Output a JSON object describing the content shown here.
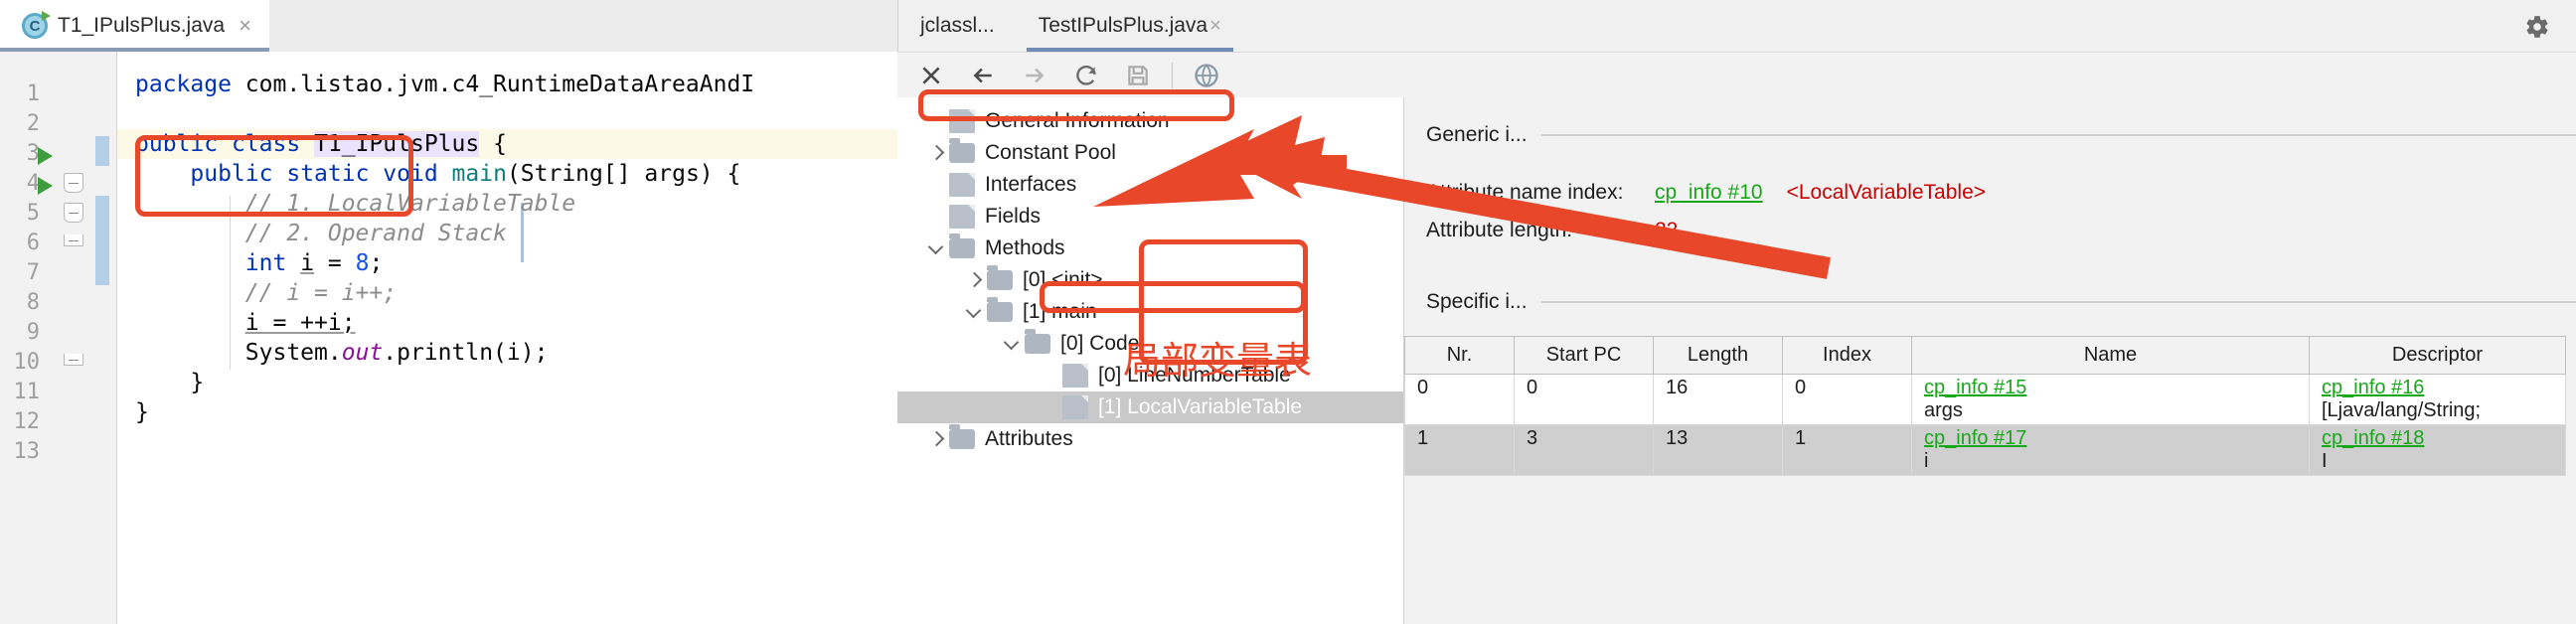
{
  "editor": {
    "tab": {
      "title": "T1_IPulsPlus.java",
      "icon": "java-class-icon",
      "close": "×"
    },
    "inspection_ok": "✓",
    "line_numbers": [
      "1",
      "2",
      "3",
      "4",
      "5",
      "6",
      "7",
      "8",
      "9",
      "10",
      "11",
      "12",
      "13"
    ],
    "lines": [
      "package com.listao.jvm.c4_RuntimeDataAreaAndI",
      "",
      "public class T1_IPulsPlus {",
      "    public static void main(String[] args) {",
      "        // 1. LocalVariableTable",
      "        // 2. Operand Stack",
      "        int i = 8;",
      "        // i = i++;",
      "        i = ++i;",
      "        System.out.println(i);",
      "    }",
      "}",
      ""
    ],
    "tokens": {
      "package_kw": "package",
      "package_name": "com.listao.jvm.c4_RuntimeDataAreaAndI",
      "public_kw": "public",
      "class_kw": "class",
      "class_name": "T1_IPulsPlus",
      "static_kw": "static",
      "void_kw": "void",
      "main_name": "main",
      "args_sig": "(String[] args) {",
      "comment1": "// 1. LocalVariableTable",
      "comment2": "// 2. Operand Stack",
      "int_kw": "int",
      "var_i": "i",
      "eq": " = ",
      "eight": "8",
      "semi": ";",
      "comment3": "// i = i++;",
      "incr": "i = ++i;",
      "sysout_system": "System.",
      "sysout_out": "out",
      "sysout_println": ".println(i);",
      "brace_close_inner": "}",
      "brace_close_outer": "}"
    }
  },
  "tool_window": {
    "tabs": [
      {
        "label": "jclassl...",
        "selected": false
      },
      {
        "label": "TestIPulsPlus.java",
        "selected": true,
        "close": "×"
      }
    ],
    "settings_icon": "gear-icon",
    "toolbar": [
      {
        "name": "close-icon",
        "glyph": "✕"
      },
      {
        "name": "back-arrow-icon",
        "glyph": "←"
      },
      {
        "name": "forward-arrow-icon",
        "glyph": "→"
      },
      {
        "name": "reload-icon",
        "glyph": "⟳"
      },
      {
        "name": "save-icon",
        "glyph": "🖫"
      },
      {
        "name": "browse-web-icon",
        "glyph": "●"
      }
    ],
    "tree": [
      {
        "label": "General Information",
        "indent": 0,
        "chev": "none",
        "icon": "doc",
        "selected": false
      },
      {
        "label": "Constant Pool",
        "indent": 0,
        "chev": "right",
        "icon": "folder",
        "selected": false
      },
      {
        "label": "Interfaces",
        "indent": 0,
        "chev": "none",
        "icon": "doc",
        "selected": false
      },
      {
        "label": "Fields",
        "indent": 0,
        "chev": "none",
        "icon": "doc",
        "selected": false
      },
      {
        "label": "Methods",
        "indent": 0,
        "chev": "down",
        "icon": "folder",
        "selected": false
      },
      {
        "label": "[0] <init>",
        "indent": 1,
        "chev": "right",
        "icon": "folder",
        "selected": false
      },
      {
        "label": "[1] main",
        "indent": 1,
        "chev": "down",
        "icon": "folder",
        "selected": false
      },
      {
        "label": "[0] Code",
        "indent": 2,
        "chev": "down",
        "icon": "folder",
        "selected": false
      },
      {
        "label": "[0] LineNumberTable",
        "indent": 3,
        "chev": "none",
        "icon": "doc",
        "selected": false
      },
      {
        "label": "[1] LocalVariableTable",
        "indent": 3,
        "chev": "none",
        "icon": "doc",
        "selected": true
      },
      {
        "label": "Attributes",
        "indent": 0,
        "chev": "right",
        "icon": "folder",
        "selected": false
      }
    ],
    "detail": {
      "generic_heading": "Generic i...",
      "specific_heading": "Specific i...",
      "rows": [
        {
          "key": "Attribute name index:",
          "link": "cp_info #10",
          "note": "<LocalVariableTable>"
        },
        {
          "key": "Attribute length:",
          "value": "22"
        }
      ],
      "table": {
        "columns": [
          "Nr.",
          "Start PC",
          "Length",
          "Index",
          "Name",
          "Descriptor"
        ],
        "rows": [
          {
            "nr": "0",
            "start_pc": "0",
            "length": "16",
            "index": "0",
            "name_link": "cp_info #15",
            "name_val": "args",
            "desc_link": "cp_info #16",
            "desc_val": "[Ljava/lang/String;"
          },
          {
            "nr": "1",
            "start_pc": "3",
            "length": "13",
            "index": "1",
            "name_link": "cp_info #17",
            "name_val": "i",
            "desc_link": "cp_info #18",
            "desc_val": "I"
          }
        ]
      }
    }
  },
  "annotations": {
    "chinese_caption": "局部变量表",
    "accent_color": "#e8472a"
  }
}
